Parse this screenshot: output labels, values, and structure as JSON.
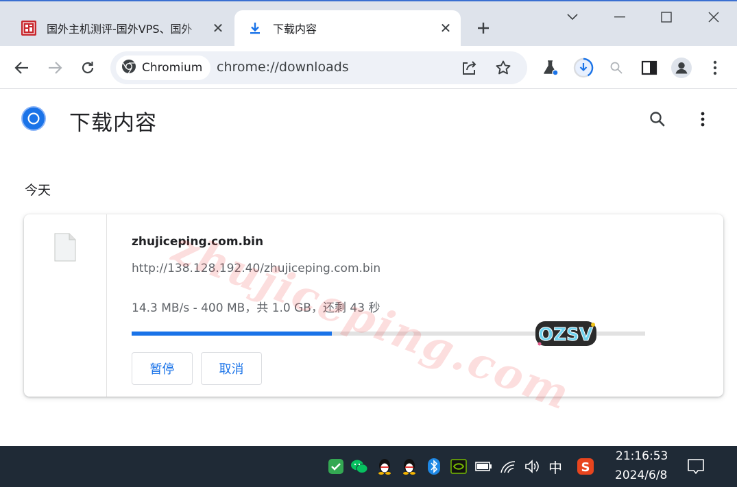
{
  "tabs": [
    {
      "title": "国外主机测评-国外VPS、国外",
      "icon": "site-seal-icon",
      "active": false
    },
    {
      "title": "下载内容",
      "icon": "download-icon",
      "active": true
    }
  ],
  "toolbar": {
    "site_chip_label": "Chromium",
    "url": "chrome://downloads"
  },
  "page": {
    "title": "下载内容",
    "section_label": "今天"
  },
  "download": {
    "filename": "zhujiceping.com.bin",
    "url": "http://138.128.192.40/zhujiceping.com.bin",
    "status": "14.3 MB/s - 400 MB，共 1.0 GB，还剩 43 秒",
    "progress_fraction": 0.39,
    "pause_label": "暂停",
    "cancel_label": "取消"
  },
  "watermark": {
    "text": "zhujiceping.com",
    "sticker_text": "OZSV"
  },
  "taskbar": {
    "time": "21:16:53",
    "date": "2024/6/8",
    "ime_label": "中"
  },
  "colors": {
    "accent": "#1a73e8",
    "tabstrip": "#dee3eb",
    "taskbar": "#1f2a36"
  }
}
